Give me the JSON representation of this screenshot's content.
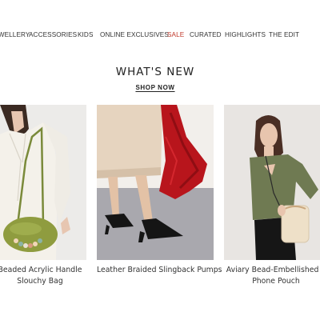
{
  "nav": {
    "items": [
      {
        "label": "JEWELLERY"
      },
      {
        "label": "ACCESSORIES"
      },
      {
        "label": "KIDS"
      },
      {
        "label": "ONLINE EXCLUSIVES"
      },
      {
        "label": "SALE"
      },
      {
        "label": "CURATED"
      },
      {
        "label": "HIGHLIGHTS"
      },
      {
        "label": "THE EDIT"
      }
    ],
    "sale_color": "#c0392b"
  },
  "hero": {
    "title": "WHAT'S NEW",
    "cta": "SHOP NOW"
  },
  "products": [
    {
      "name_line1": "Beaded Acrylic Handle",
      "name_line2": "Slouchy Bag"
    },
    {
      "name_line1": "Leather Braided Slingback Pumps",
      "name_line2": ""
    },
    {
      "name_line1": "Aviary Bead-Embellished S",
      "name_line2": "Phone Pouch"
    }
  ]
}
